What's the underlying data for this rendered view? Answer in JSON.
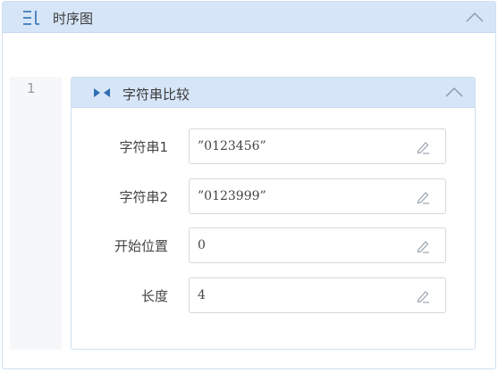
{
  "panel": {
    "title": "时序图",
    "title_icon": "list-icon",
    "collapse_icon": "chevron-up-icon"
  },
  "editor": {
    "line_number": "1"
  },
  "card": {
    "title": "字符串比较",
    "icon": "compare-arrows-icon",
    "collapse_icon": "chevron-up-icon",
    "fields": [
      {
        "label": "字符串1",
        "value": "”0123456”",
        "icon": "edit-icon"
      },
      {
        "label": "字符串2",
        "value": "”0123999”",
        "icon": "edit-icon"
      },
      {
        "label": "开始位置",
        "value": "0",
        "icon": "edit-icon"
      },
      {
        "label": "长度",
        "value": "4",
        "icon": "edit-icon"
      }
    ]
  },
  "colors": {
    "header_bg": "#d6e6f8",
    "border": "#cfe0f2",
    "accent": "#2f6fb3"
  }
}
